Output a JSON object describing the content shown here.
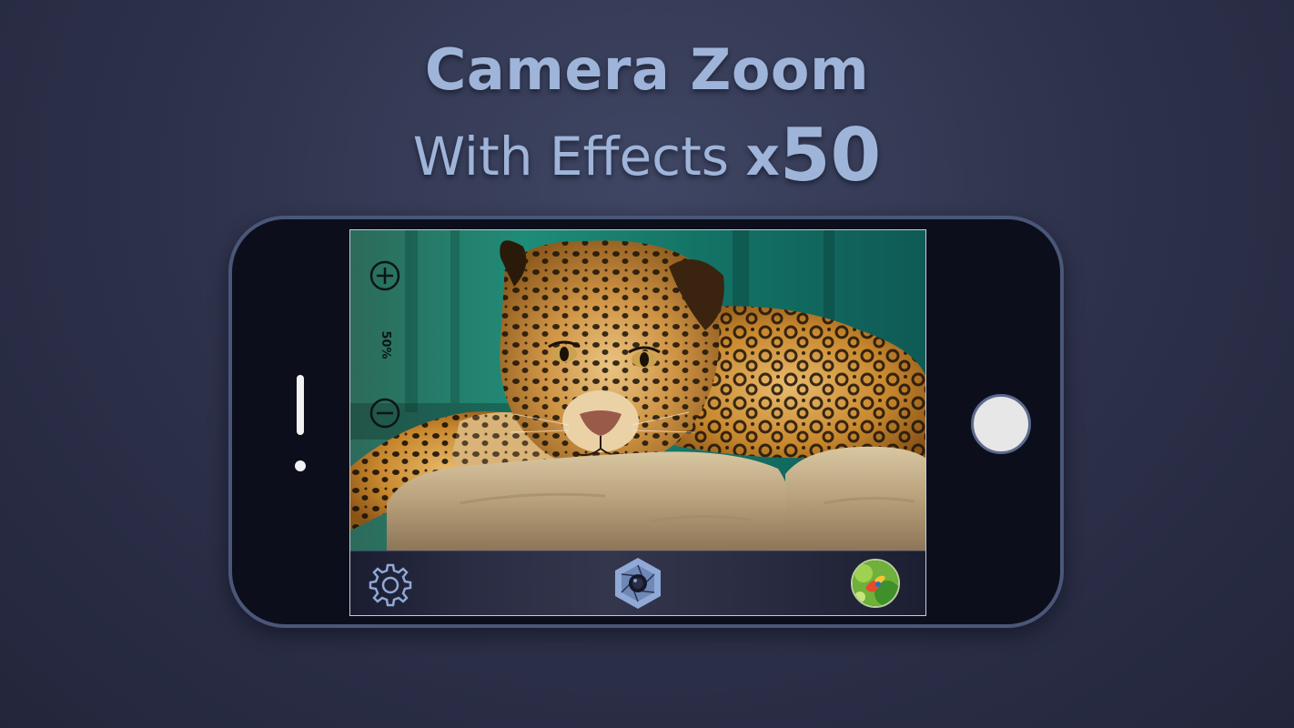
{
  "header": {
    "title": "Camera Zoom",
    "subtitle_prefix": "With Effects ",
    "multiplier_x": "x",
    "multiplier_value": "50"
  },
  "camera": {
    "zoom_label": "50%",
    "zoom_percent": 50
  },
  "icons": {
    "zoom_in": "plus-circle-icon",
    "zoom_out": "minus-circle-icon",
    "settings": "gear-icon",
    "shutter": "aperture-shutter-icon",
    "gallery": "gallery-thumbnail"
  },
  "colors": {
    "headline": "#9fb4d9",
    "background": "#2c3049",
    "phone_body": "#0c0e1b",
    "phone_border": "#4a5779",
    "accent_icon": "#90a9d6"
  }
}
